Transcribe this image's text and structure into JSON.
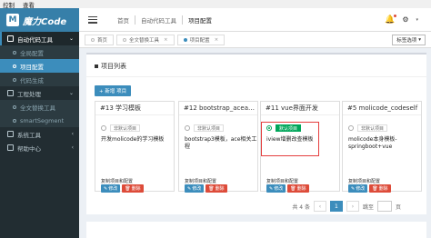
{
  "menubar": {
    "items": [
      "控制",
      "查看"
    ]
  },
  "logo": {
    "mark": "M",
    "text": "魔力Code"
  },
  "sidebar": {
    "groups": [
      {
        "label": "自动代码工具",
        "items": [
          "全局配置",
          "项目配置",
          "代码生成"
        ]
      },
      {
        "label": "工程处理",
        "items": [
          "全文替换工具",
          "smartSegment"
        ]
      },
      {
        "label": "系统工具",
        "items": []
      },
      {
        "label": "帮助中心",
        "items": []
      }
    ],
    "active_item": "项目配置"
  },
  "breadcrumb": [
    "首页",
    "自动代码工具",
    "项目配置"
  ],
  "tabs": [
    {
      "label": "首页",
      "active": false
    },
    {
      "label": "全文替换工具",
      "active": false
    },
    {
      "label": "项目配置",
      "active": true
    }
  ],
  "tab_options_label": "标签选项",
  "box": {
    "title": "项目列表",
    "new_button": "+ 新增 项目"
  },
  "cards": [
    {
      "title": "#13 学习模板",
      "default_label": "非默认项目",
      "is_default": false,
      "desc": "开发molicode的学习模板"
    },
    {
      "title": "#12 bootstrap_acea…",
      "default_label": "非默认项目",
      "is_default": false,
      "desc": "bootstrap3模板，ace相关工程"
    },
    {
      "title": "#11 vue界面开发",
      "default_label": "默认项目",
      "is_default": true,
      "desc": "iview增删改查模板"
    },
    {
      "title": "#5 molicode_codeself",
      "default_label": "非默认项目",
      "is_default": false,
      "desc": "molicode本身模板-springboot+vue"
    }
  ],
  "card_actions": {
    "copy": "复制项目和配置",
    "edit": "修改",
    "delete": "删除"
  },
  "pagination": {
    "total_text": "共 4 条",
    "prev": "‹",
    "current": "1",
    "next": "›",
    "goto_label": "跳至",
    "page_suffix": "页"
  },
  "colors": {
    "sidebar": "#222d32",
    "accent": "#3c8dbc",
    "danger": "#dd4b39",
    "success": "#00a65a",
    "highlight": "#e53e3e"
  }
}
